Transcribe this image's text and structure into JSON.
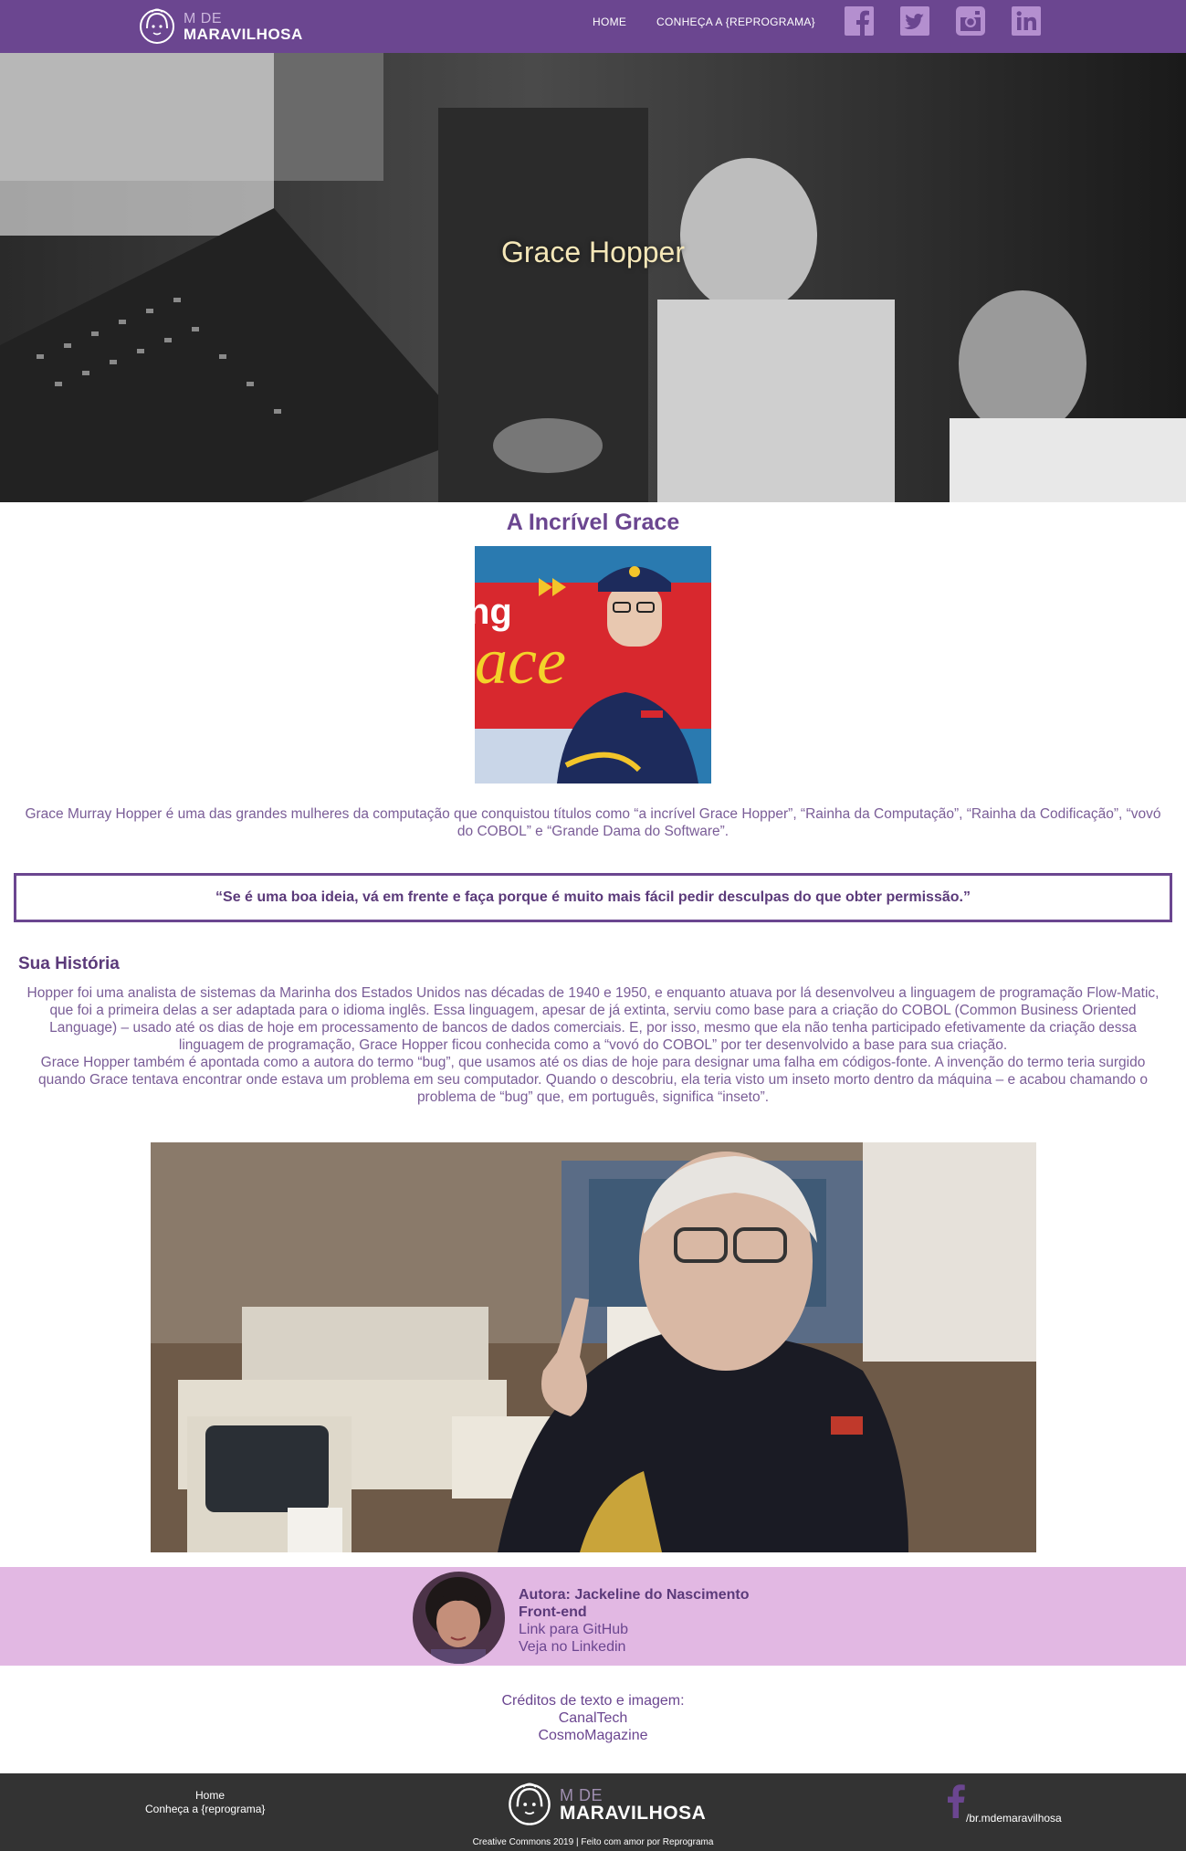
{
  "nav": {
    "logo_top": "M DE",
    "logo_bottom": "MARAVILHOSA",
    "links": [
      "HOME",
      "CONHEÇA A {REPROGRAMA}"
    ],
    "social_icons": [
      "facebook-icon",
      "twitter-icon",
      "instagram-icon",
      "linkedin-icon"
    ]
  },
  "hero": {
    "title": "Grace Hopper"
  },
  "main": {
    "heading": "A Incrível Grace",
    "intro": "Grace Murray Hopper é uma das grandes mulheres da computação que conquistou títulos como “a incrível Grace Hopper”, “Rainha da Computação”, “Rainha da Codificação”, “vovó do COBOL” e “Grande Dama do Software”.",
    "quote": "“Se é uma boa ideia, vá em frente e faça porque é muito mais fácil pedir desculpas do que obter permissão.”",
    "history_heading": "Sua História",
    "history_p1": "Hopper foi uma analista de sistemas da Marinha dos Estados Unidos nas décadas de 1940 e 1950, e enquanto atuava por lá desenvolveu a linguagem de programação Flow-Matic, que foi a primeira delas a ser adaptada para o idioma inglês. Essa linguagem, apesar de já extinta, serviu como base para a criação do COBOL (Common Business Oriented Language) – usado até os dias de hoje em processamento de bancos de dados comerciais. E, por isso, mesmo que ela não tenha participado efetivamente da criação dessa linguagem de programação, Grace Hopper ficou conhecida como a “vovó do COBOL” por ter desenvolvido a base para sua criação.",
    "history_p2": "Grace Hopper também é apontada como a autora do termo “bug”, que usamos até os dias de hoje para designar uma falha em códigos-fonte. A invenção do termo teria surgido quando Grace tentava encontrar onde estava um problema em seu computador. Quando o descobriu, ela teria visto um inseto morto dentro da máquina – e acabou chamando o problema de “bug” que, em português, significa “inseto”."
  },
  "author": {
    "name": "Autora: Jackeline do Nascimento",
    "role": "Front-end",
    "github": "Link para GitHub",
    "linkedin": "Veja no Linkedin"
  },
  "credits": {
    "title": "Créditos de texto e imagem:",
    "links": [
      "CanalTech",
      "CosmoMagazine"
    ]
  },
  "footer": {
    "links": [
      "Home",
      "Conheça a {reprograma}"
    ],
    "logo_top": "M DE",
    "logo_bottom": "MARAVILHOSA",
    "handle": "/br.mdemaravilhosa",
    "copyright": "Creative Commons 2019 | Feito com amor por Reprograma"
  },
  "colors": {
    "nav_bg": "#6b4690",
    "author_bg": "#e2b8e3",
    "footer_bg": "#333333",
    "hero_title": "#f5e7b8"
  }
}
